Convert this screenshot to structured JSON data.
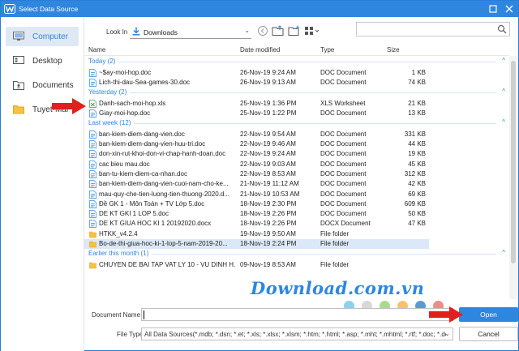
{
  "window": {
    "title": "Select Data Source"
  },
  "sidebar": {
    "items": [
      {
        "label": "Computer",
        "icon": "computer-icon",
        "active": true
      },
      {
        "label": "Desktop",
        "icon": "desktop-icon"
      },
      {
        "label": "Documents",
        "icon": "documents-icon"
      },
      {
        "label": "Tuyet-Mai",
        "icon": "folder-icon"
      }
    ]
  },
  "toolbar": {
    "look_in_label": "Look In",
    "look_in_value": "Downloads",
    "search_placeholder": ""
  },
  "columns": {
    "name": "Name",
    "date": "Date modified",
    "type": "Type",
    "size": "Size"
  },
  "groups": [
    {
      "label": "Today (2)",
      "rows": [
        {
          "name": "~$ay-moi-hop.doc",
          "date": "26-Nov-19 9:24 AM",
          "type": "DOC Document",
          "size": "1 KB",
          "icon": "doc"
        },
        {
          "name": "Lich-thi-dau-Sea-games-30.doc",
          "date": "26-Nov-19 9:13 AM",
          "type": "DOC Document",
          "size": "74 KB",
          "icon": "doc"
        }
      ]
    },
    {
      "label": "Yesterday (2)",
      "rows": [
        {
          "name": "Danh-sach-moi-hop.xls",
          "date": "25-Nov-19 1:36 PM",
          "type": "XLS Worksheet",
          "size": "21 KB",
          "icon": "xls"
        },
        {
          "name": "Giay-moi-hop.doc",
          "date": "25-Nov-19 1:22 PM",
          "type": "DOC Document",
          "size": "13 KB",
          "icon": "doc"
        }
      ]
    },
    {
      "label": "Last week (12)",
      "rows": [
        {
          "name": "ban-kiem-diem-dang-vien.doc",
          "date": "22-Nov-19 9:54 AM",
          "type": "DOC Document",
          "size": "331 KB",
          "icon": "doc"
        },
        {
          "name": "ban-kiem-diem-dang-vien-huu-tri.doc",
          "date": "22-Nov-19 9:46 AM",
          "type": "DOC Document",
          "size": "44 KB",
          "icon": "doc"
        },
        {
          "name": "don-xin-rut-khoi-don-vi-chap-hanh-doan.doc",
          "date": "22-Nov-19 9:24 AM",
          "type": "DOC Document",
          "size": "19 KB",
          "icon": "doc"
        },
        {
          "name": "cac bieu mau.doc",
          "date": "22-Nov-19 9:03 AM",
          "type": "DOC Document",
          "size": "45 KB",
          "icon": "doc"
        },
        {
          "name": "ban-tu-kiem-diem-ca-nhan.doc",
          "date": "22-Nov-19 8:53 AM",
          "type": "DOC Document",
          "size": "312 KB",
          "icon": "doc"
        },
        {
          "name": "ban-kiem-diem-dang-vien-cuoi-nam-cho-ke...",
          "date": "21-Nov-19 11:12 AM",
          "type": "DOC Document",
          "size": "42 KB",
          "icon": "doc"
        },
        {
          "name": "mau-quy-che-tien-luong-tien-thuong-2020.d...",
          "date": "21-Nov-19 10:53 AM",
          "type": "DOC Document",
          "size": "69 KB",
          "icon": "doc"
        },
        {
          "name": "Đề GK 1 - Môn Toán + TV  Lớp 5.doc",
          "date": "18-Nov-19 2:30 PM",
          "type": "DOC Document",
          "size": "609 KB",
          "icon": "doc"
        },
        {
          "name": "DE KT GKI 1 LOP 5.doc",
          "date": "18-Nov-19 2:26 PM",
          "type": "DOC Document",
          "size": "50 KB",
          "icon": "doc"
        },
        {
          "name": "DE KT GIUA HOC KI 1  20192020.docx",
          "date": "18-Nov-19 2:26 PM",
          "type": "DOCX Document",
          "size": "47 KB",
          "icon": "docx"
        },
        {
          "name": "HTKK_v4.2.4",
          "date": "19-Nov-19 9:50 AM",
          "type": "File folder",
          "size": "",
          "icon": "folder"
        },
        {
          "name": "Bo-de-thi-giua-hoc-ki-1-lop-5-nam-2019-20...",
          "date": "18-Nov-19 2:24 PM",
          "type": "File folder",
          "size": "",
          "icon": "folder",
          "selected": true
        }
      ]
    },
    {
      "label": "Earlier this month (1)",
      "rows": [
        {
          "name": "CHUYEN DE BAI TAP VAT LY 10 - VU DINH H...",
          "date": "09-Nov-19 8:53 AM",
          "type": "File folder",
          "size": "",
          "icon": "folder"
        }
      ]
    }
  ],
  "bottom": {
    "document_name_label": "Document Name",
    "document_name_value": "",
    "file_type_label": "File Type",
    "file_type_value": "All Data Sources(*.mdb; *.dsn; *.et; *.xls; *.xlsx; *.xlsm; *.htm; *.html; *.asp; *.mht; *.mhtml; *.rtf; *.doc; *.dot;",
    "open_label": "Open",
    "cancel_label": "Cancel"
  },
  "watermark": {
    "text": "Download.com.vn"
  },
  "colors": {
    "accent": "#2f86df",
    "selected_row": "#dbe8f7",
    "arrow": "#e0201c"
  }
}
